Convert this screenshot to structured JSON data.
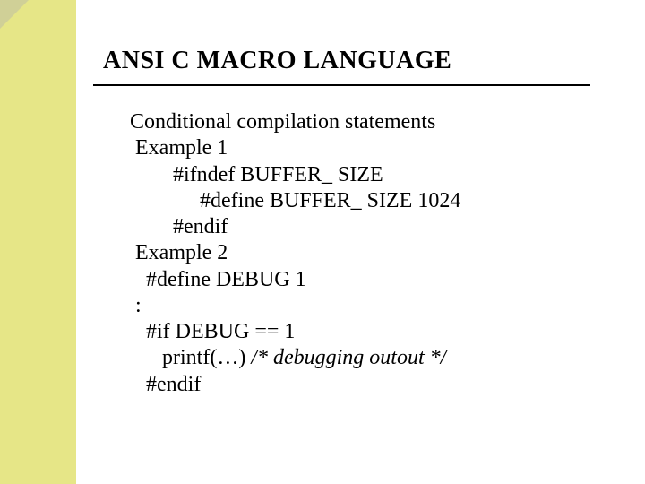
{
  "title": "ANSI C MACRO LANGUAGE",
  "content": {
    "intro": "Conditional compilation statements",
    "ex1_label": " Example 1",
    "ex1_l1": "        #ifndef BUFFER_ SIZE",
    "ex1_l2": "             #define BUFFER_ SIZE 1024",
    "ex1_l3": "        #endif",
    "ex2_label": " Example 2",
    "ex2_l1": "   #define DEBUG 1",
    "colon": " :",
    "ex2_l2": "   #if DEBUG == 1",
    "ex2_l3a": "      printf(…) ",
    "ex2_l3b": "/* debugging outout */",
    "ex2_l4": "   #endif"
  }
}
